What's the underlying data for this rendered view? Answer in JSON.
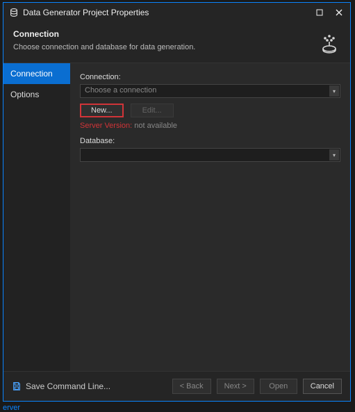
{
  "window": {
    "title": "Data Generator Project Properties"
  },
  "header": {
    "title": "Connection",
    "description": "Choose connection and database for data generation."
  },
  "sidebar": {
    "items": [
      {
        "label": "Connection"
      },
      {
        "label": "Options"
      }
    ]
  },
  "content": {
    "connection_label": "Connection:",
    "connection_placeholder": "Choose a connection",
    "new_button": "New...",
    "edit_button": "Edit...",
    "server_version_label": "Server Version:",
    "server_version_value": "not available",
    "database_label": "Database:",
    "database_value": ""
  },
  "footer": {
    "save_command": "Save Command Line...",
    "back": "< Back",
    "next": "Next >",
    "open": "Open",
    "cancel": "Cancel"
  },
  "status": "erver"
}
